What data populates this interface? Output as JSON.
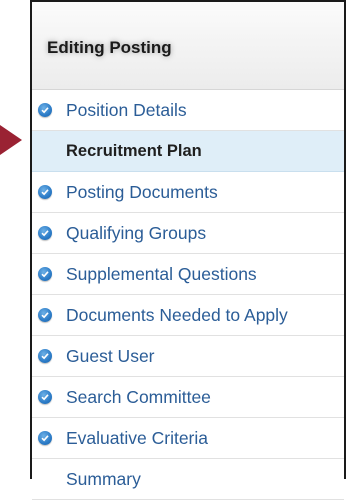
{
  "panel": {
    "title": "Editing Posting",
    "items": [
      {
        "label": "Position Details",
        "checked": true,
        "active": false
      },
      {
        "label": "Recruitment Plan",
        "checked": false,
        "active": true
      },
      {
        "label": "Posting Documents",
        "checked": true,
        "active": false
      },
      {
        "label": "Qualifying Groups",
        "checked": true,
        "active": false
      },
      {
        "label": "Supplemental Questions",
        "checked": true,
        "active": false
      },
      {
        "label": "Documents Needed to Apply",
        "checked": true,
        "active": false
      },
      {
        "label": "Guest User",
        "checked": true,
        "active": false
      },
      {
        "label": "Search Committee",
        "checked": true,
        "active": false
      },
      {
        "label": "Evaluative Criteria",
        "checked": true,
        "active": false
      },
      {
        "label": "Summary",
        "checked": false,
        "active": false
      }
    ]
  },
  "colors": {
    "link": "#2b5d97",
    "active_bg": "#dfeef8",
    "check": "#2b7bc7",
    "arrow": "#9a2233"
  }
}
